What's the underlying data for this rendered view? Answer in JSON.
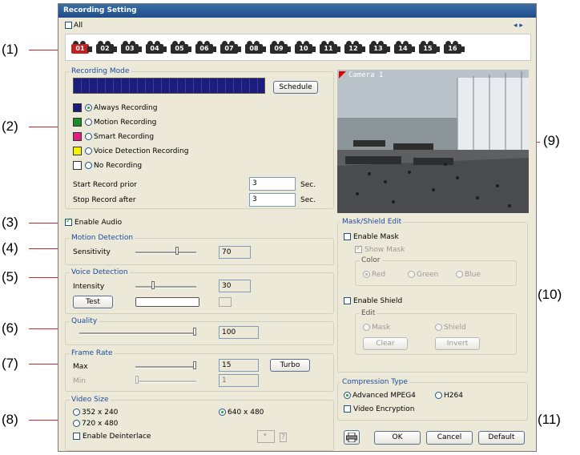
{
  "callouts": [
    "(1)",
    "(2)",
    "(3)",
    "(4)",
    "(5)",
    "(6)",
    "(7)",
    "(8)",
    "(9)",
    "(10)",
    "(11)"
  ],
  "window": {
    "title": "Recording Setting"
  },
  "channels": {
    "all_label": "All",
    "nav_arrows": "◂ ▸",
    "items": [
      "01",
      "02",
      "03",
      "04",
      "05",
      "06",
      "07",
      "08",
      "09",
      "10",
      "11",
      "12",
      "13",
      "14",
      "15",
      "16"
    ],
    "selected": "01"
  },
  "recording_mode": {
    "title": "Recording Mode",
    "schedule_label": "Schedule",
    "options": [
      {
        "label": "Always Recording",
        "color": "#1c1c7a",
        "selected": true
      },
      {
        "label": "Motion Recording",
        "color": "#1f8a2a",
        "selected": false
      },
      {
        "label": "Smart Recording",
        "color": "#e0207e",
        "selected": false
      },
      {
        "label": "Voice Detection Recording",
        "color": "#f6f200",
        "selected": false
      },
      {
        "label": "No Recording",
        "color": "#ffffff",
        "selected": false
      }
    ],
    "start_label": "Start Record prior",
    "start_value": "3",
    "start_unit": "Sec.",
    "stop_label": "Stop Record after",
    "stop_value": "3",
    "stop_unit": "Sec.",
    "timeline_color": "#1c1c7a"
  },
  "camera_preview": {
    "label": "Camera 1"
  },
  "audio": {
    "label": "Enable Audio",
    "checked": true
  },
  "motion": {
    "title": "Motion Detection",
    "sensitivity_label": "Sensitivity",
    "value": "70",
    "level": 0.7
  },
  "voice": {
    "title": "Voice Detection",
    "intensity_label": "Intensity",
    "value": "30",
    "level": 0.3,
    "test_label": "Test"
  },
  "quality": {
    "title": "Quality",
    "value": "100",
    "level": 1.0
  },
  "frame_rate": {
    "title": "Frame Rate",
    "max_label": "Max",
    "max_value": "15",
    "max_level": 1.0,
    "min_label": "Min",
    "min_value": "1",
    "min_level": 0.0,
    "turbo_label": "Turbo"
  },
  "video_size": {
    "title": "Video Size",
    "opt1": "352 x 240",
    "opt2": "640 x 480",
    "opt3": "720 x 480",
    "selected": "640 x 480",
    "deinterlace_label": "Enable Deinterlace",
    "help": "?"
  },
  "mask": {
    "title": "Mask/Shield Edit",
    "enable_mask": "Enable Mask",
    "show_mask": "Show Mask",
    "color_title": "Color",
    "red": "Red",
    "green": "Green",
    "blue": "Blue",
    "enable_shield": "Enable Shield",
    "edit_title": "Edit",
    "mask_opt": "Mask",
    "shield_opt": "Shield",
    "clear_label": "Clear",
    "invert_label": "Invert"
  },
  "compression": {
    "title": "Compression Type",
    "opt1": "Advanced MPEG4",
    "opt2": "H264",
    "encryption_label": "Video Encryption"
  },
  "footer": {
    "ok": "OK",
    "cancel": "Cancel",
    "default": "Default"
  }
}
